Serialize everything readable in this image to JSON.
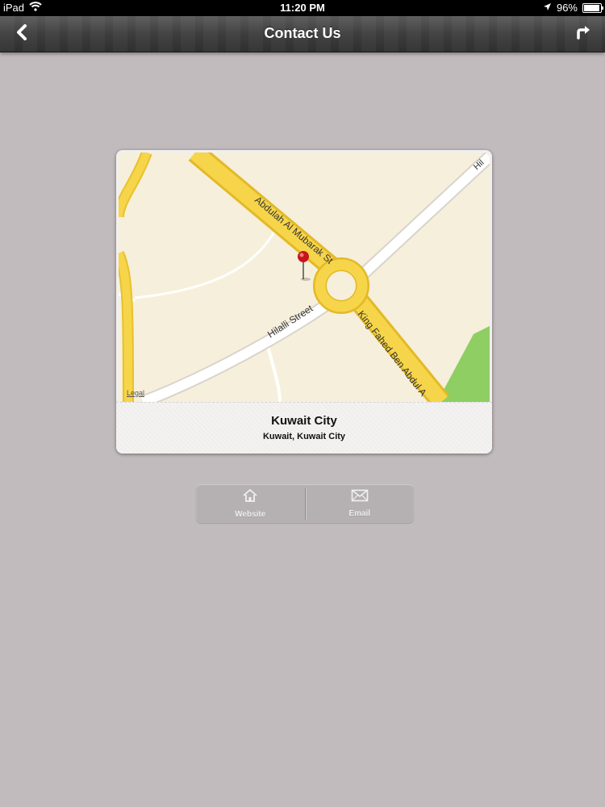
{
  "status_bar": {
    "device": "iPad",
    "time": "11:20 PM",
    "battery": "96%",
    "battery_level": 0.96
  },
  "nav_bar": {
    "title": "Contact Us"
  },
  "map": {
    "roads": {
      "abdulah": "Abdulah Al Mubarak St",
      "hilalli": "Hilalli Street",
      "king_fahed": "King Fahed Ben Abdul A",
      "hil": "Hil"
    },
    "legal": "Legal"
  },
  "location": {
    "name": "Kuwait City",
    "subtitle": "Kuwait, Kuwait City"
  },
  "actions": {
    "website": "Website",
    "email": "Email"
  },
  "colors": {
    "background": "#c2bbbd",
    "map_land": "#f6efdb",
    "road_major": "#f3cf3a",
    "road_minor": "#ffffff",
    "park": "#8fce63",
    "pin": "#c8141a"
  }
}
